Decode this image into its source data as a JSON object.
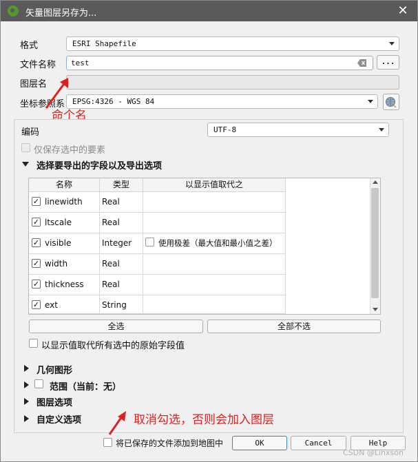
{
  "window": {
    "title": "矢量图层另存为..."
  },
  "form": {
    "format_label": "格式",
    "format_value": "ESRI Shapefile",
    "filename_label": "文件名称",
    "filename_value": "test",
    "filename_browse": "...",
    "layername_label": "图层名",
    "crs_label": "坐标参照系",
    "crs_value": "EPSG:4326 - WGS 84"
  },
  "annotations": {
    "rename": "命个名",
    "uncheck": "取消勾选，否则会加入图层"
  },
  "options": {
    "encoding_label": "编码",
    "encoding_value": "UTF-8",
    "save_selected_label": "仅保存选中的要素",
    "fields_section": "选择要导出的字段以及导出选项",
    "fields_columns": [
      "名称",
      "类型",
      "以显示值取代之"
    ],
    "fields_rows": [
      {
        "name": "linewidth",
        "type": "Real",
        "checked": true
      },
      {
        "name": "ltscale",
        "type": "Real",
        "checked": true
      },
      {
        "name": "visible",
        "type": "Integer",
        "checked": true,
        "replace_label": "使用极差（最大值和最小值之差）"
      },
      {
        "name": "width",
        "type": "Real",
        "checked": true
      },
      {
        "name": "thickness",
        "type": "Real",
        "checked": true
      },
      {
        "name": "ext",
        "type": "String",
        "checked": true
      }
    ],
    "select_all": "全选",
    "deselect_all": "全部不选",
    "replace_all_label": "以显示值取代所有选中的原始字段值",
    "geometry_section": "几何图形",
    "extent_section": "范围（当前：无）",
    "layer_options_section": "图层选项",
    "custom_options_section": "自定义选项"
  },
  "footer": {
    "add_to_map_label": "将已保存的文件添加到地图中",
    "ok": "OK",
    "cancel": "Cancel",
    "help": "Help"
  },
  "watermark": "CSDN @Linxson",
  "colors": {
    "titlebar": "#5a5a5a",
    "annotation_red": "#e02020",
    "default_button_border": "#3b7fc4"
  }
}
